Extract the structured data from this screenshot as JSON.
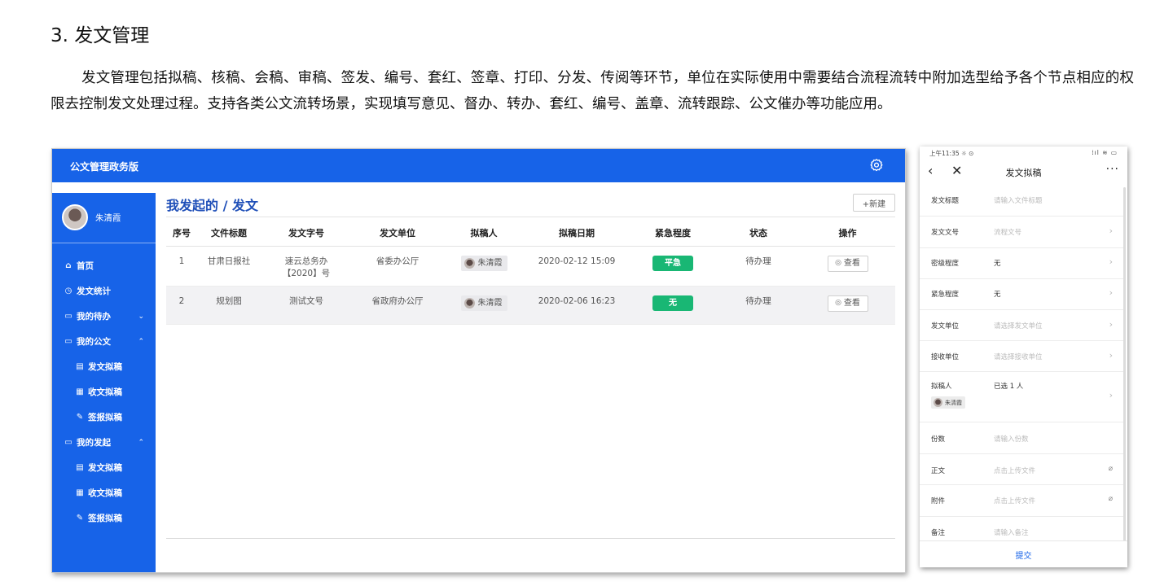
{
  "document": {
    "heading": "3. 发文管理",
    "paragraph": "发文管理包括拟稿、核稿、会稿、审稿、签发、编号、套红、签章、打印、分发、传阅等环节，单位在实际使用中需要结合流程流转中附加选型给予各个节点相应的权限去控制发文处理过程。支持各类公文流转场景，实现填写意见、督办、转办、套红、编号、盖章、流转跟踪、公文催办等功能应用。"
  },
  "desktop": {
    "app_title": "公文管理政务版",
    "header_color": "#1763e8",
    "header_icon": "gear-icon",
    "user": {
      "name": "朱清霞"
    },
    "nav": [
      {
        "label": "首页",
        "icon": "home-icon",
        "sub": false,
        "chevron": ""
      },
      {
        "label": "发文统计",
        "icon": "clock-icon",
        "sub": false,
        "chevron": ""
      },
      {
        "label": "我的待办",
        "icon": "folder-icon",
        "sub": false,
        "chevron": "⌄"
      },
      {
        "label": "我的公文",
        "icon": "folder-icon",
        "sub": false,
        "chevron": "⌃"
      },
      {
        "label": "发文拟稿",
        "icon": "edit-doc-icon",
        "sub": true,
        "chevron": ""
      },
      {
        "label": "收文拟稿",
        "icon": "doc-icon",
        "sub": true,
        "chevron": ""
      },
      {
        "label": "签报拟稿",
        "icon": "edit-icon",
        "sub": true,
        "chevron": ""
      },
      {
        "label": "我的发起",
        "icon": "folder-icon",
        "sub": false,
        "chevron": "⌃"
      },
      {
        "label": "发文拟稿",
        "icon": "edit-doc-icon",
        "sub": true,
        "chevron": ""
      },
      {
        "label": "收文拟稿",
        "icon": "doc-icon",
        "sub": true,
        "chevron": ""
      },
      {
        "label": "签报拟稿",
        "icon": "edit-icon",
        "sub": true,
        "chevron": ""
      }
    ],
    "page_title": "我发起的 / 发文",
    "new_button": "+新建",
    "table": {
      "headers": [
        "序号",
        "文件标题",
        "发文字号",
        "发文单位",
        "拟稿人",
        "拟稿日期",
        "紧急程度",
        "状态",
        "操作"
      ],
      "rows": [
        {
          "index": "1",
          "title": "甘肃日报社",
          "doc_no": "速云总务办【2020】号",
          "unit": "省委办公厅",
          "author": "朱清霞",
          "date": "2020-02-12 15:09",
          "urgency": "平急",
          "status": "待办理",
          "action": "查看"
        },
        {
          "index": "2",
          "title": "规划图",
          "doc_no": "测试文号",
          "unit": "省政府办公厅",
          "author": "朱清霞",
          "date": "2020-02-06 16:23",
          "urgency": "无",
          "status": "待办理",
          "action": "查看"
        }
      ]
    },
    "urgency_color": "#19b774"
  },
  "mobile": {
    "status_time": "上午11:35 ☼ ⊙",
    "status_icons": "⁞ıl ≋ ▭",
    "title": "发文拟稿",
    "fields": {
      "subject": {
        "label": "发文标题",
        "placeholder": "请输入文件标题"
      },
      "doc_no": {
        "label": "发文文号",
        "placeholder": "流程文号"
      },
      "secrecy": {
        "label": "密级程度",
        "value": "无"
      },
      "urgency": {
        "label": "紧急程度",
        "value": "无"
      },
      "sender": {
        "label": "发文单位",
        "placeholder": "请选择发文单位"
      },
      "receiver": {
        "label": "接收单位",
        "placeholder": "请选择接收单位"
      },
      "drafter": {
        "label": "拟稿人",
        "value": "已选 1 人",
        "chip": "朱清霞"
      },
      "copies": {
        "label": "份数",
        "placeholder": "请输入份数"
      },
      "body": {
        "label": "正文",
        "placeholder": "点击上传文件"
      },
      "attachment": {
        "label": "附件",
        "placeholder": "点击上传文件"
      },
      "remark": {
        "label": "备注",
        "placeholder": "请输入备注"
      }
    },
    "submit": "提交",
    "accent": "#1763e8"
  }
}
